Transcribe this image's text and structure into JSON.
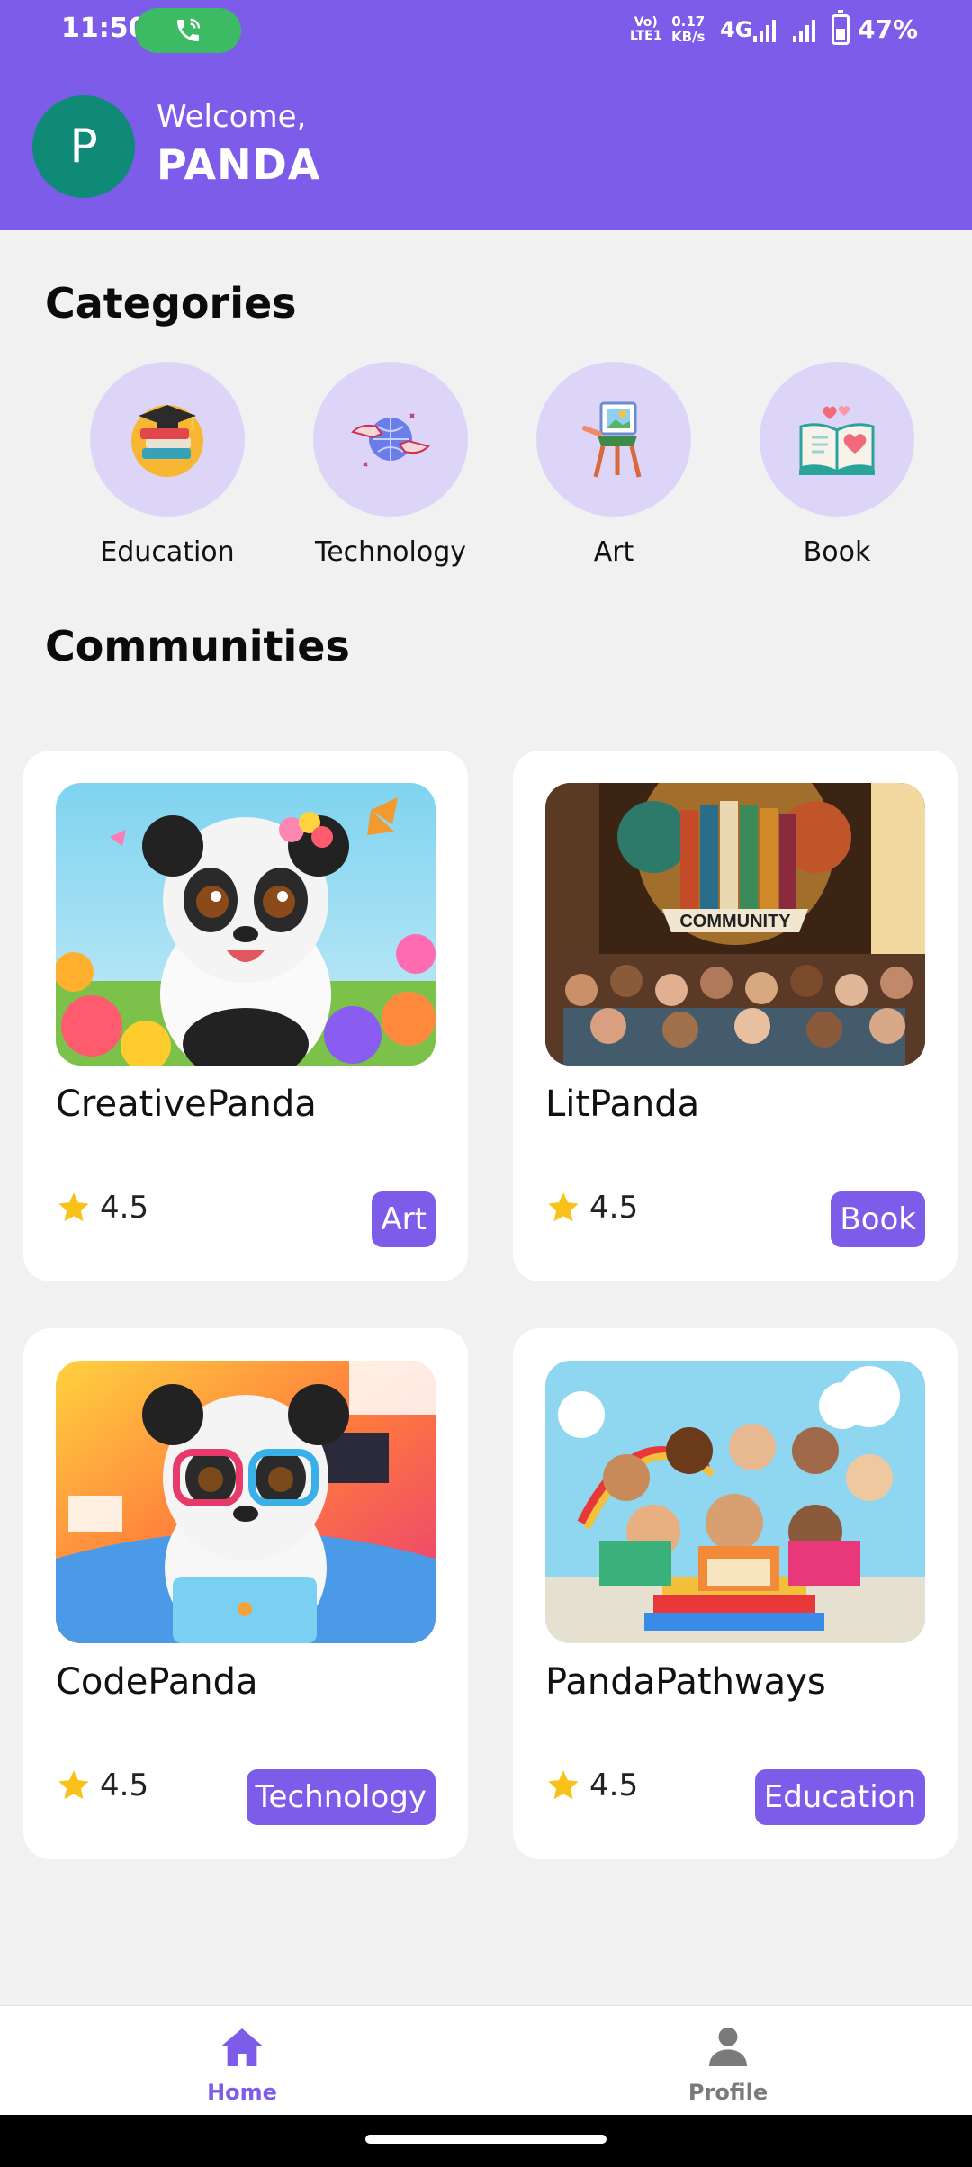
{
  "status_bar": {
    "time": "11:50",
    "volte_line1": "Vo)",
    "volte_line2": "LTE1",
    "speed_value": "0.17",
    "speed_unit": "KB/s",
    "network": "4G",
    "battery": "47%",
    "battery_level": 0.47
  },
  "header": {
    "avatar_letter": "P",
    "welcome": "Welcome,",
    "username": "PANDA",
    "color": "#7c5ce8"
  },
  "categories": {
    "title": "Categories",
    "items": [
      {
        "label": "Education",
        "icon": "graduation-books-icon"
      },
      {
        "label": "Technology",
        "icon": "globe-hands-icon"
      },
      {
        "label": "Art",
        "icon": "easel-icon"
      },
      {
        "label": "Book",
        "icon": "open-book-hearts-icon"
      }
    ]
  },
  "communities": {
    "title": "Communities",
    "items": [
      {
        "name": "CreativePanda",
        "rating": "4.5",
        "tag": "Art",
        "image": "panda-flowers-image"
      },
      {
        "name": "LitPanda",
        "rating": "4.5",
        "tag": "Book",
        "image": "library-community-image"
      },
      {
        "name": "CodePanda",
        "rating": "4.5",
        "tag": "Technology",
        "image": "panda-laptop-image"
      },
      {
        "name": "PandaPathways",
        "rating": "4.5",
        "tag": "Education",
        "image": "kids-reading-image"
      }
    ]
  },
  "bottom_nav": {
    "home": "Home",
    "profile": "Profile",
    "active_color": "#7c5ce8",
    "inactive_color": "#7a7a7a"
  }
}
